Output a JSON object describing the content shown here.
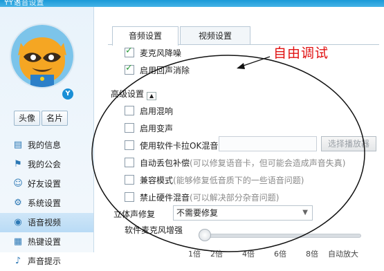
{
  "window": {
    "title": "YY语音设置",
    "controls": "— ×"
  },
  "colors": {
    "accent": "#1a9ad8",
    "annotation": "#e01010",
    "check": "#2a9a3a"
  },
  "profile": {
    "avatar_icon": "raccoon-mascot-avatar",
    "badge": "Y"
  },
  "profile_tabs": {
    "avatar_label": "头像",
    "card_label": "名片"
  },
  "sidebar": {
    "items": [
      {
        "label": "我的信息",
        "icon": "user-info-icon"
      },
      {
        "label": "我的公会",
        "icon": "guild-flag-icon"
      },
      {
        "label": "好友设置",
        "icon": "friends-icon"
      },
      {
        "label": "系统设置",
        "icon": "gear-icon"
      },
      {
        "label": "语音视频",
        "icon": "voice-video-icon",
        "active": true
      },
      {
        "label": "热键设置",
        "icon": "keyboard-icon"
      },
      {
        "label": "声音提示",
        "icon": "sound-icon"
      }
    ]
  },
  "tabs": {
    "audio": "音频设置",
    "video": "视频设置"
  },
  "audio": {
    "noise_reduction": {
      "label": "麦克风降噪",
      "checked": true
    },
    "echo_cancel": {
      "label": "启用回声消除",
      "checked": true
    },
    "advanced_label": "高级设置",
    "mixing": {
      "label": "启用混响",
      "checked": false
    },
    "voice_change": {
      "label": "启用变声",
      "checked": false
    },
    "karaoke": {
      "label": "使用软件卡拉OK混音",
      "checked": false,
      "button": "选择播放器"
    },
    "auto_drop": {
      "label": "自动丢包补偿",
      "hint": "(可以修复语音卡，但可能会造成声音失真)",
      "checked": false
    },
    "compat": {
      "label": "兼容模式",
      "hint": "(能够修复低音质下的一些语音问题)",
      "checked": false
    },
    "hw_mix": {
      "label": "禁止硬件混音",
      "hint": "(可以解决部分杂音问题)",
      "checked": false
    },
    "stereo": {
      "label": "立体声修复",
      "value": "不需要修复"
    },
    "mic_boost": {
      "label": "软件麦克风增强",
      "level": 0,
      "ticks": [
        "1倍",
        "2倍",
        "4倍",
        "6倍",
        "8倍",
        "自动放大"
      ]
    }
  },
  "annotation": {
    "text": "自由调试"
  }
}
